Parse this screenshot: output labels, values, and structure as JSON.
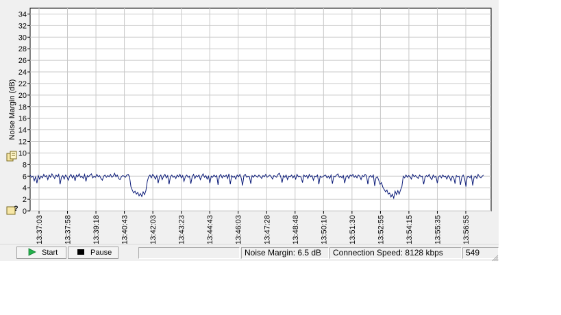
{
  "chart_data": {
    "type": "line",
    "ylabel": "Noise Margin (dB)",
    "xlabel": "",
    "ylim": [
      0,
      35
    ],
    "yticks": [
      0,
      2,
      4,
      6,
      8,
      10,
      12,
      14,
      16,
      18,
      20,
      22,
      24,
      26,
      28,
      30,
      32,
      34
    ],
    "grid": true,
    "x_tick_labels": [
      "13:37:03",
      "13:37:58",
      "13:39:18",
      "13:40:43",
      "13:42:03",
      "13:43:23",
      "13:44:43",
      "13:46:03",
      "13:47:28",
      "13:48:48",
      "13:50:10",
      "13:51:30",
      "13:52:55",
      "13:54:15",
      "13:55:35",
      "13:56:55"
    ],
    "series": [
      {
        "color": "#0a1a78",
        "values": [
          6.2,
          5.8,
          6.0,
          5.2,
          5.9,
          4.8,
          6.1,
          5.5,
          6.0,
          5.7,
          6.3,
          5.9,
          6.1,
          5.4,
          6.2,
          5.8,
          6.4,
          6.0,
          5.6,
          6.2,
          5.9,
          6.3,
          4.6,
          5.8,
          6.1,
          5.5,
          6.2,
          5.9,
          5.3,
          6.0,
          6.3,
          5.7,
          6.1,
          5.2,
          6.2,
          5.9,
          6.4,
          5.8,
          6.0,
          5.6,
          6.3,
          5.1,
          6.1,
          5.9,
          6.2,
          6.4,
          5.7,
          6.0,
          5.8,
          6.3,
          5.9,
          6.1,
          5.6,
          5.3,
          6.0,
          6.2,
          5.8,
          6.1,
          5.9,
          6.3,
          5.8,
          6.0,
          6.5,
          5.9,
          6.2,
          5.6,
          5.4,
          5.9,
          6.1,
          6.0,
          5.8,
          6.2,
          6.3,
          5.9,
          4.2,
          3.6,
          3.1,
          3.4,
          2.9,
          3.2,
          2.6,
          3.0,
          2.5,
          3.3,
          2.8,
          3.5,
          5.1,
          5.9,
          6.2,
          5.7,
          6.3,
          6.0,
          5.5,
          6.1,
          4.8,
          5.9,
          6.2,
          5.4,
          6.0,
          6.3,
          5.7,
          6.1,
          4.6,
          5.9,
          6.2,
          5.8,
          6.0,
          5.6,
          6.2,
          5.9,
          6.3,
          5.7,
          6.1,
          5.1,
          5.9,
          6.2,
          5.8,
          6.0,
          4.7,
          5.9,
          6.3,
          5.6,
          6.1,
          5.9,
          6.2,
          5.4,
          6.0,
          6.4,
          5.8,
          6.1,
          5.5,
          6.0,
          4.8,
          6.0,
          5.8,
          6.2,
          5.9,
          6.1,
          4.5,
          6.0,
          6.3,
          5.7,
          6.1,
          5.9,
          6.2,
          5.6,
          6.4,
          4.6,
          6.1,
          5.8,
          6.0,
          5.5,
          6.2,
          5.9,
          6.3,
          5.7,
          4.4,
          6.1,
          6.3,
          5.8,
          6.0,
          5.9,
          4.7,
          6.1,
          5.8,
          6.2,
          6.0,
          5.8,
          6.2,
          5.9,
          5.6,
          6.1,
          5.9,
          6.3,
          5.8,
          6.0,
          6.2,
          5.9,
          5.5,
          6.1,
          6.0,
          5.8,
          6.3,
          6.5,
          5.9,
          4.9,
          6.1,
          5.8,
          6.2,
          5.4,
          6.0,
          5.9,
          6.2,
          5.7,
          6.1,
          5.5,
          6.3,
          5.9,
          6.0,
          5.8,
          4.9,
          6.2,
          5.9,
          6.1,
          5.6,
          6.3,
          5.9,
          6.1,
          5.3,
          6.0,
          5.9,
          6.2,
          4.6,
          6.0,
          5.8,
          5.9,
          6.1,
          6.2,
          5.7,
          6.0,
          5.6,
          6.2,
          4.7,
          6.0,
          5.9,
          6.2,
          6.4,
          5.8,
          6.0,
          5.7,
          6.1,
          4.8,
          5.9,
          6.1,
          5.6,
          6.2,
          6.0,
          6.3,
          5.8,
          6.1,
          5.7,
          6.2,
          6.0,
          5.4,
          6.1,
          5.9,
          6.3,
          6.1,
          4.6,
          5.9,
          6.1,
          5.8,
          6.2,
          4.3,
          5.7,
          5.9,
          5.3,
          4.6,
          4.9,
          4.1,
          3.7,
          3.3,
          3.6,
          2.9,
          3.1,
          2.4,
          2.9,
          2.2,
          3.4,
          2.8,
          3.5,
          2.9,
          3.6,
          4.2,
          6.0,
          5.7,
          6.2,
          5.8,
          6.1,
          5.9,
          5.5,
          6.3,
          5.9,
          6.1,
          5.8,
          5.6,
          6.2,
          5.9,
          6.0,
          4.6,
          5.8,
          6.1,
          5.9,
          6.3,
          5.7,
          5.4,
          6.2,
          5.8,
          6.0,
          4.8,
          5.9,
          6.1,
          5.7,
          6.2,
          5.9,
          6.0,
          5.5,
          6.1,
          5.8,
          5.2,
          6.0,
          5.8,
          4.7,
          6.1,
          5.9,
          6.0,
          4.5,
          5.8,
          6.2,
          5.6,
          4.2,
          5.9,
          6.0,
          5.7,
          6.1,
          4.4,
          5.8,
          6.0,
          5.6,
          6.3,
          5.9,
          5.7,
          6.0,
          6.2
        ]
      }
    ]
  },
  "side_icons": [
    "copy-icon",
    "help-icon"
  ],
  "toolbar": {
    "start_label": "Start",
    "pause_label": "Pause"
  },
  "status": {
    "blank": "",
    "noise_margin": "Noise Margin: 6.5 dB",
    "connection_speed": "Connection Speed: 8128 kbps",
    "count": "549"
  },
  "colors": {
    "window_bg": "#f0f0f0",
    "plot_bg": "#ffffff",
    "grid": "#c8c8c8",
    "line": "#0a1a78",
    "start_icon": "#22b14c",
    "pause_icon": "#000000"
  }
}
